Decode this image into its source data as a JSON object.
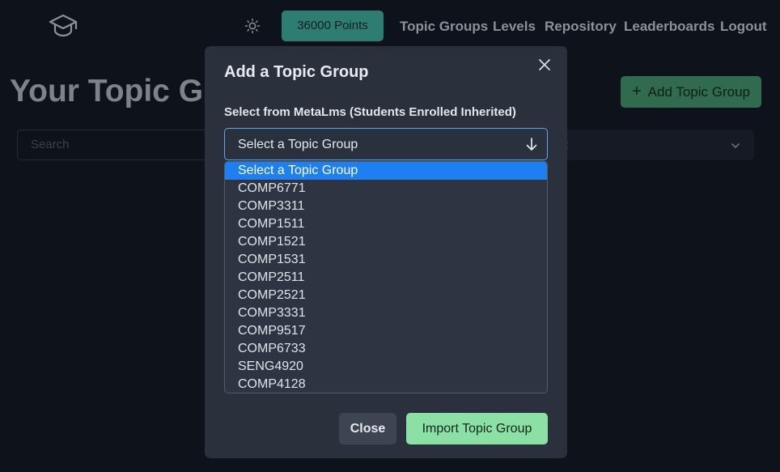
{
  "nav": {
    "points": "36000 Points",
    "links": [
      "Topic Groups",
      "Levels",
      "Repository",
      "Leaderboards",
      "Logout"
    ]
  },
  "page": {
    "title": "Your Topic Gr",
    "add_button": "Add Topic Group",
    "search_placeholder": "Search",
    "sort_label": "rt"
  },
  "modal": {
    "title": "Add a Topic Group",
    "field_label": "Select from MetaLms (Students Enrolled Inherited)",
    "select_value": "Select a Topic Group",
    "options": [
      "Select a Topic Group",
      "COMP6771",
      "COMP3311",
      "COMP1511",
      "COMP1521",
      "COMP1531",
      "COMP2511",
      "COMP2521",
      "COMP3331",
      "COMP9517",
      "COMP6733",
      "SENG4920",
      "COMP4128"
    ],
    "selected_index": 0,
    "close_button": "Close",
    "import_button": "Import Topic Group"
  },
  "colors": {
    "accent_teal": "#2e7d73",
    "import_green": "#8be0a6",
    "option_highlight": "#1d7ff0"
  }
}
